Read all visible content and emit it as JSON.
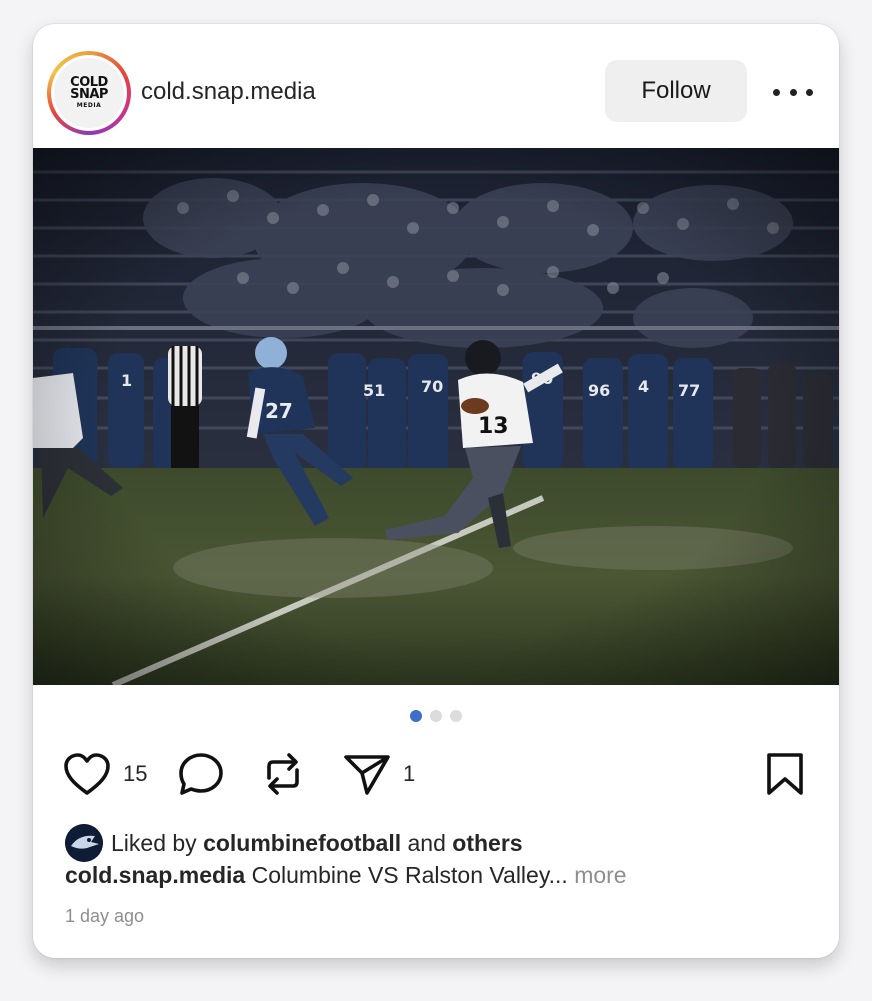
{
  "post": {
    "account": {
      "username": "cold.snap.media",
      "avatar_logo_text": [
        "COLD",
        "SNAP",
        "MEDIA"
      ]
    },
    "follow_label": "Follow",
    "more_icon": "ellipsis-horizontal-icon",
    "carousel": {
      "current_index": 1,
      "total": 3,
      "active_color": "#3b6fc9"
    },
    "photo": {
      "jersey_numbers": [
        "27",
        "13",
        "1",
        "51",
        "70",
        "90",
        "96",
        "4",
        "77",
        "1"
      ]
    },
    "actions": {
      "like_icon": "heart-icon",
      "like_count": "15",
      "comment_icon": "comment-bubble-icon",
      "repost_icon": "repost-icon",
      "share_icon": "paper-plane-icon",
      "share_count": "1",
      "save_icon": "bookmark-icon"
    },
    "liked_by": {
      "prefix": "Liked by",
      "user": "columbinefootball",
      "conjunction": "and",
      "others": "others"
    },
    "caption": {
      "username": "cold.snap.media",
      "text": "Columbine VS Ralston Valley...",
      "more_label": "more"
    },
    "timestamp": "1 day ago"
  }
}
